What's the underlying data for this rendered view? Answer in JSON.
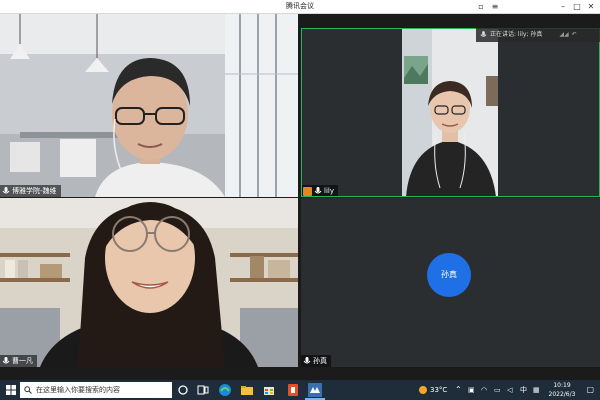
{
  "window": {
    "title": "腾讯会议"
  },
  "speaker_banner": {
    "text": "正在讲话: lily; 孙真"
  },
  "participants": [
    {
      "name": "博雅学院-魏维"
    },
    {
      "name": "lily"
    },
    {
      "name": "曹一凡"
    },
    {
      "name": "孙真",
      "avatar_text": "孙真"
    }
  ],
  "taskbar": {
    "search_placeholder": "在这里输入你要搜索的内容",
    "weather": "33°C",
    "ime": "中",
    "time": "10:19",
    "date": "2022/6/3"
  },
  "colors": {
    "active_speaker_frame": "#21b85a",
    "avatar_blue": "#1f6fe6",
    "taskbar": "#1f2d3a"
  }
}
